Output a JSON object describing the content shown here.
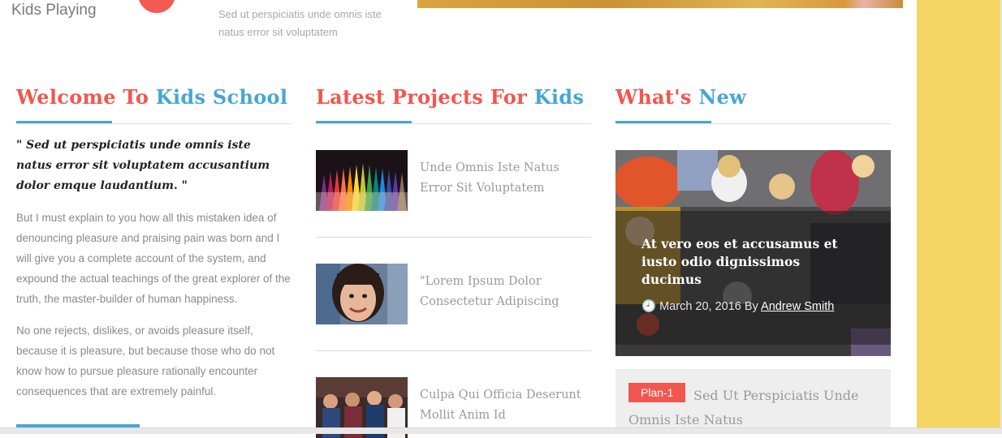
{
  "top": {
    "kids_playing": "Kids Playing",
    "snippet": "Sed ut perspiciatis unde omnis iste natus error sit voluptatem"
  },
  "welcome": {
    "title_part1": "Welcome To",
    "title_part2": "Kids School",
    "quote": "\" Sed ut perspiciatis unde omnis iste natus error sit voluptatem accusantium dolor emque laudantium. \"",
    "paragraph1": "But I must explain to you how all this mistaken idea of denouncing pleasure and praising pain was born and I will give you a complete account of the system, and expound the actual teachings of the great explorer of the truth, the master-builder of human happiness.",
    "paragraph2": "No one rejects, dislikes, or avoids pleasure itself, because it is pleasure, but because those who do not know how to pursue pleasure rationally encounter consequences that are extremely painful."
  },
  "projects": {
    "title_part1": "Latest Projects For",
    "title_part2": "Kids",
    "items": [
      {
        "text": "Unde Omnis Iste Natus Error Sit Voluptatem",
        "thumb": "colored-pencils"
      },
      {
        "text": "\"Lorem Ipsum Dolor Consectetur Adipiscing",
        "thumb": "smiling-girl"
      },
      {
        "text": "Culpa Qui Officia Deserunt Mollit Anim Id",
        "thumb": "kids-group"
      }
    ]
  },
  "news": {
    "title_part1": "What's",
    "title_part2": "New",
    "card_title": "At vero eos et accusamus et iusto odio dignissimos ducimus",
    "date": "March 20, 2016",
    "by": "By",
    "author": "Andrew Smith",
    "plan_badge": "Plan-1",
    "plan_text": "Sed Ut Perspiciatis Unde Omnis Iste Natus"
  },
  "colors": {
    "accent_red": "#f2564e",
    "accent_blue": "#48a6d4",
    "side_yellow": "#f5d564"
  }
}
